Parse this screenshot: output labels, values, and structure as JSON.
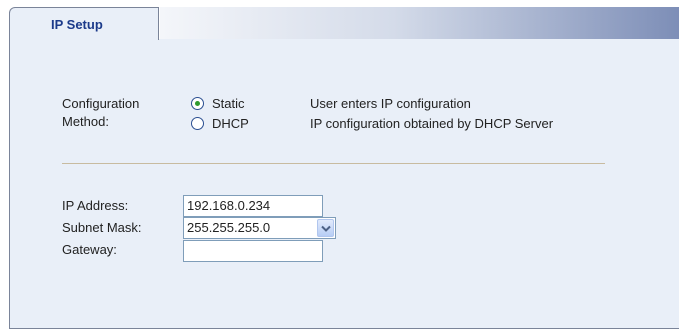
{
  "tab": {
    "label": "IP Setup"
  },
  "config": {
    "label_line1": "Configuration",
    "label_line2": "Method:",
    "options": [
      {
        "label": "Static",
        "description": "User enters IP configuration",
        "selected": true
      },
      {
        "label": "DHCP",
        "description": "IP configuration obtained by DHCP Server",
        "selected": false
      }
    ]
  },
  "fields": {
    "ip_address": {
      "label": "IP Address:",
      "value": "192.168.0.234"
    },
    "subnet_mask": {
      "label": "Subnet Mask:",
      "value": "255.255.255.0"
    },
    "gateway": {
      "label": "Gateway:",
      "value": ""
    }
  },
  "icons": {
    "radio_selected": "radio-selected-icon",
    "radio_unselected": "radio-unselected-icon",
    "dropdown": "chevron-down-icon"
  },
  "colors": {
    "panel_bg": "#e9eff8",
    "tab_text": "#1b3a8a",
    "radio_dot": "#2f9a2f"
  }
}
